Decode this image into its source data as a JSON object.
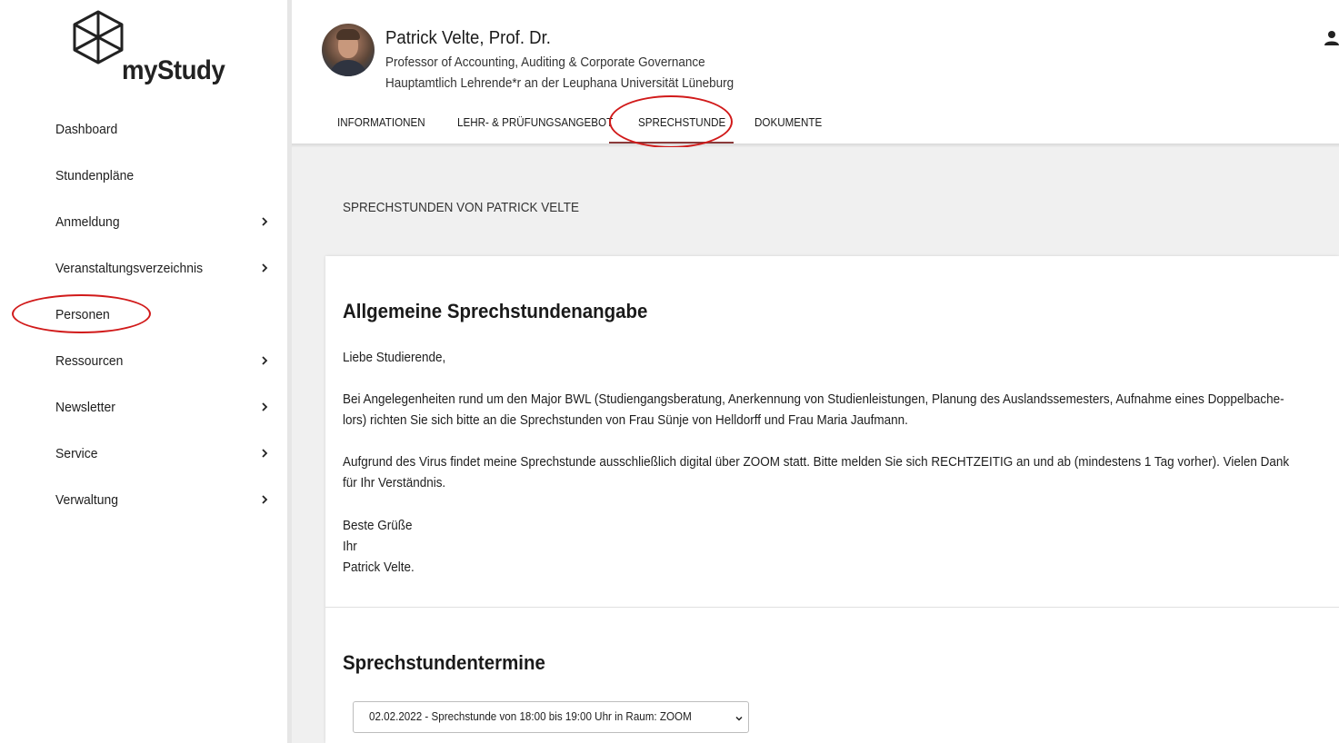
{
  "app": {
    "logo_text": "myStudy"
  },
  "sidebar": {
    "items": [
      {
        "label": "Dashboard",
        "has_submenu": false
      },
      {
        "label": "Stundenpläne",
        "has_submenu": false
      },
      {
        "label": "Anmeldung",
        "has_submenu": true
      },
      {
        "label": "Veranstaltungsverzeichnis",
        "has_submenu": true
      },
      {
        "label": "Personen",
        "has_submenu": false,
        "highlighted": true
      },
      {
        "label": "Ressourcen",
        "has_submenu": true
      },
      {
        "label": "Newsletter",
        "has_submenu": true
      },
      {
        "label": "Service",
        "has_submenu": true
      },
      {
        "label": "Verwaltung",
        "has_submenu": true
      }
    ]
  },
  "profile": {
    "name": "Patrick Velte, Prof. Dr.",
    "title": "Professor of Accounting, Auditing & Corporate Governance",
    "role": "Hauptamtlich Lehrende*r an der Leuphana Universität Lüneburg"
  },
  "tabs": [
    {
      "label": "INFORMATIONEN",
      "active": false
    },
    {
      "label": "LEHR- & PRÜFUNGSANGEBOT",
      "active": false
    },
    {
      "label": "SPRECHSTUNDE",
      "active": true
    },
    {
      "label": "DOKUMENTE",
      "active": false
    }
  ],
  "main": {
    "section_heading": "SPRECHSTUNDEN VON PATRICK VELTE",
    "general": {
      "title": "Allgemeine Sprechstundenangabe",
      "greeting": "Liebe Studierende,",
      "paragraph1_line1": "Bei Angelegenheiten rund um den Major BWL (Studiengangsberatung, Anerkennung von Studienleistungen, Planung des Auslandssemesters, Aufnahme eines Doppelbache-",
      "paragraph1_line2": "lors) richten Sie sich bitte an die Sprechstunden von Frau Sünje von Helldorff und Frau Maria Jaufmann.",
      "paragraph2_line1": "Aufgrund des Virus findet meine Sprechstunde ausschließlich digital über ZOOM statt. Bitte melden Sie sich RECHTZEITIG an und ab (mindestens 1 Tag vorher). Vielen Dank",
      "paragraph2_line2": "für Ihr Verständnis.",
      "closing1": "Beste Grüße",
      "closing2": "Ihr",
      "closing3": "Patrick Velte."
    },
    "termine": {
      "title": "Sprechstundentermine",
      "selected": "02.02.2022 - Sprechstunde von 18:00 bis 19:00 Uhr in Raum: ZOOM"
    }
  },
  "colors": {
    "accent": "#8b3a3a",
    "annotation_circle": "#d11a1a",
    "background_main": "#f0f0f0"
  },
  "icons": {
    "logo": "hexagon-cube-icon",
    "chevron": "chevron-right-icon",
    "user": "user-icon",
    "dropdown": "chevron-down-icon"
  }
}
